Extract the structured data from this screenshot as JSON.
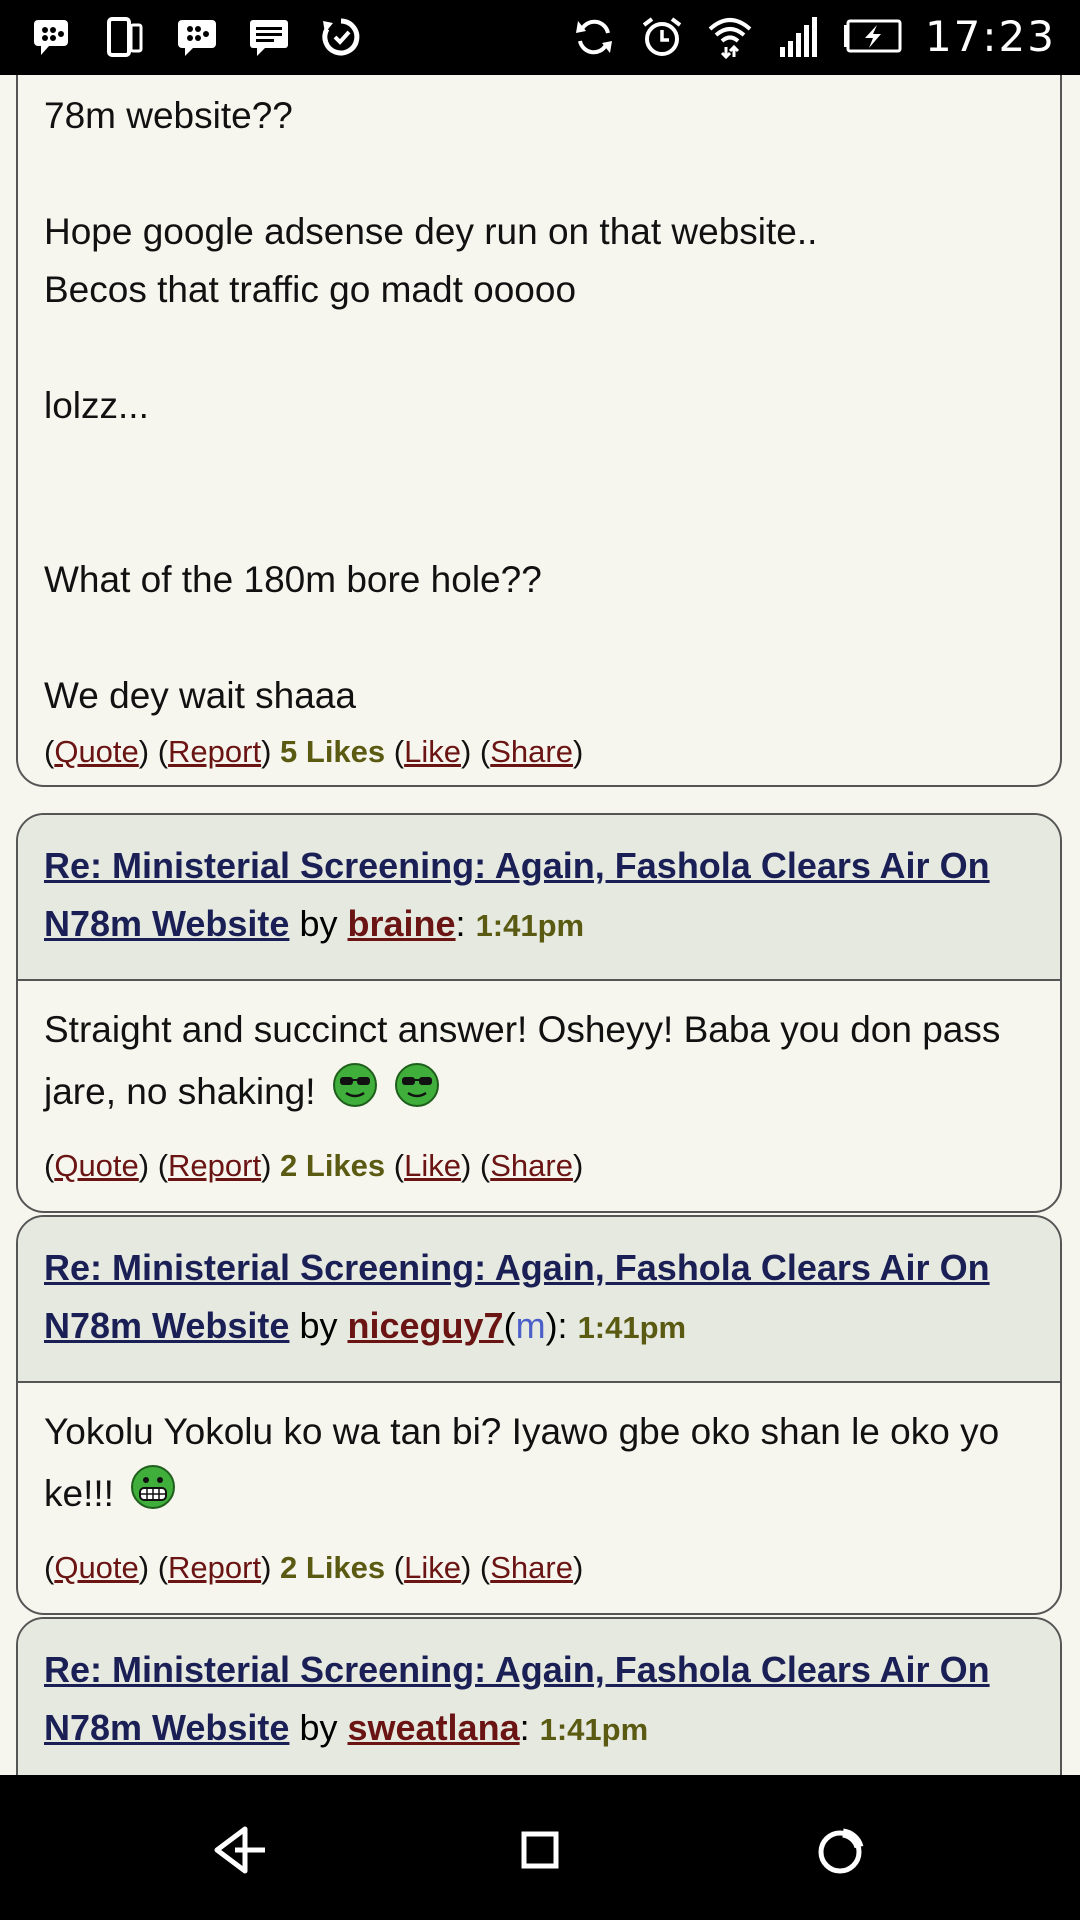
{
  "status_bar": {
    "time": "17:23",
    "left_icons": [
      "bbm-icon",
      "phone-icon",
      "bbm-chat-icon",
      "message-icon",
      "sync-icon"
    ],
    "right_icons": [
      "sync-icon",
      "alarm-icon",
      "wifi-icon",
      "signal-icon",
      "battery-charging-icon"
    ]
  },
  "posts": [
    {
      "body_lines": [
        "78m website??",
        "",
        "Hope google adsense dey run on that website..",
        "Becos that traffic go madt ooooo",
        "",
        "lolzz...",
        "",
        "",
        "What of the 180m bore hole??",
        "",
        "We dey wait shaaa"
      ],
      "likes": "5 Likes"
    },
    {
      "thread_title": "Re: Ministerial Screening: Again, Fashola Clears Air On N78m Website",
      "by": "by",
      "user": "braine",
      "time": "1:41pm",
      "body_text": "Straight and succinct answer! Osheyy! Baba you don pass jare, no shaking!",
      "likes": "2 Likes"
    },
    {
      "thread_title": "Re: Ministerial Screening: Again, Fashola Clears Air On N78m Website",
      "by": "by",
      "user": "niceguy7",
      "mod_tag": "m",
      "time": "1:41pm",
      "body_text": "Yokolu Yokolu ko wa tan bi? Iyawo gbe oko shan le oko yo ke!!!",
      "likes": "2 Likes"
    },
    {
      "thread_title": "Re: Ministerial Screening: Again, Fashola Clears Air On N78m Website",
      "by": "by",
      "user": "sweatlana",
      "time": "1:41pm"
    }
  ],
  "actions": {
    "quote": "Quote",
    "report": "Report",
    "like": "Like",
    "share": "Share"
  },
  "nav_bar": [
    "back-icon",
    "home-icon",
    "recents-icon"
  ]
}
